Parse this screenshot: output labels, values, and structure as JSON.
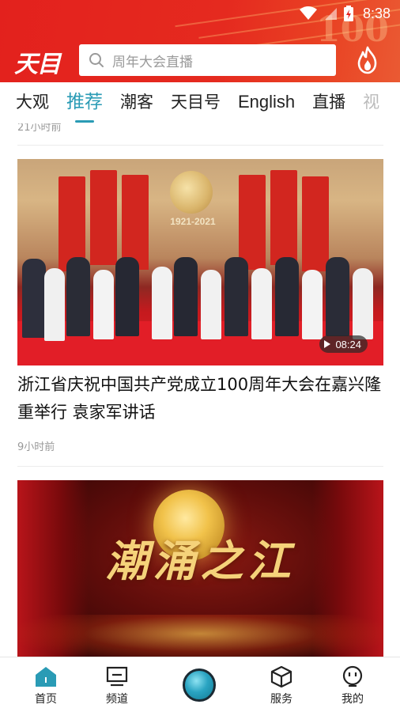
{
  "status_bar": {
    "time": "8:38"
  },
  "header": {
    "logo": "天目",
    "search_placeholder": "周年大会直播",
    "deco_text": "100"
  },
  "tabs": [
    {
      "label": "大观",
      "active": false
    },
    {
      "label": "推荐",
      "active": true
    },
    {
      "label": "潮客",
      "active": false
    },
    {
      "label": "天目号",
      "active": false
    },
    {
      "label": "English",
      "active": false
    },
    {
      "label": "直播",
      "active": false
    },
    {
      "label": "视",
      "active": false
    }
  ],
  "feed": {
    "prev_item_time": "21小时前",
    "items": [
      {
        "video_duration": "08:24",
        "image_text": "1921-2021",
        "title": "浙江省庆祝中国共产党成立100周年大会在嘉兴隆重举行 袁家军讲话",
        "time": "9小时前"
      },
      {
        "image_text": "潮涌之江"
      }
    ]
  },
  "bottom_nav": [
    {
      "label": "首页",
      "icon": "home-icon",
      "active": true
    },
    {
      "label": "频道",
      "icon": "channel-icon",
      "active": false
    },
    {
      "label": "",
      "icon": "center-orb-icon",
      "active": false
    },
    {
      "label": "服务",
      "icon": "service-cube-icon",
      "active": false
    },
    {
      "label": "我的",
      "icon": "profile-icon",
      "active": false
    }
  ],
  "colors": {
    "header_red": "#e3211d",
    "accent_teal": "#2a9bb5"
  }
}
